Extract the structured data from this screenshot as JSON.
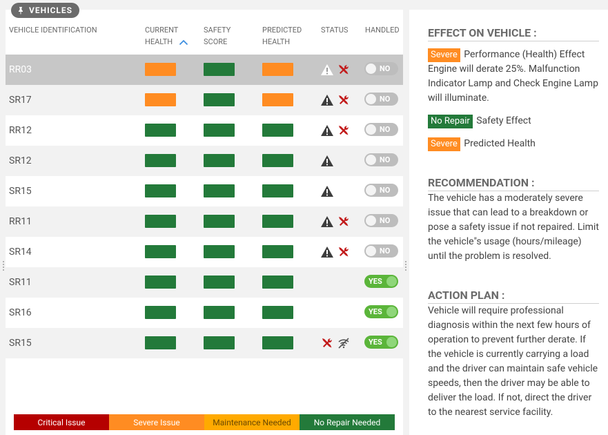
{
  "panel_label": "VEHICLES",
  "columns": {
    "vehicle_id": "VEHICLE IDENTIFICATION",
    "current_health": [
      "CURRENT",
      "HEALTH"
    ],
    "safety_score": [
      "SAFETY",
      "SCORE"
    ],
    "predicted_health": [
      "PREDICTED",
      "HEALTH"
    ],
    "status": "STATUS",
    "handled": "HANDLED"
  },
  "colors": {
    "critical": "#b50000",
    "severe": "#ff8c22",
    "maintenance": "#ffaa00",
    "no_repair": "#237a3a"
  },
  "rows": [
    {
      "id": "RR03",
      "current": "severe",
      "safety": "no_repair",
      "predicted": "severe",
      "status": [
        "warning",
        "wrench"
      ],
      "handled": "NO",
      "selected": true
    },
    {
      "id": "SR17",
      "current": "severe",
      "safety": "no_repair",
      "predicted": "severe",
      "status": [
        "warning",
        "wrench"
      ],
      "handled": "NO"
    },
    {
      "id": "RR12",
      "current": "no_repair",
      "safety": "no_repair",
      "predicted": "no_repair",
      "status": [
        "warning",
        "wrench"
      ],
      "handled": "NO"
    },
    {
      "id": "SR12",
      "current": "no_repair",
      "safety": "no_repair",
      "predicted": "no_repair",
      "status": [
        "warning"
      ],
      "handled": "NO"
    },
    {
      "id": "SR15",
      "current": "no_repair",
      "safety": "no_repair",
      "predicted": "no_repair",
      "status": [
        "warning"
      ],
      "handled": "NO"
    },
    {
      "id": "RR11",
      "current": "no_repair",
      "safety": "no_repair",
      "predicted": "no_repair",
      "status": [
        "warning",
        "wrench"
      ],
      "handled": "NO"
    },
    {
      "id": "SR14",
      "current": "no_repair",
      "safety": "no_repair",
      "predicted": "no_repair",
      "status": [
        "warning",
        "wrench"
      ],
      "handled": "NO"
    },
    {
      "id": "SR11",
      "current": "no_repair",
      "safety": "no_repair",
      "predicted": "no_repair",
      "status": [],
      "handled": "YES"
    },
    {
      "id": "SR16",
      "current": "no_repair",
      "safety": "no_repair",
      "predicted": "no_repair",
      "status": [],
      "handled": "YES"
    },
    {
      "id": "SR15",
      "current": "no_repair",
      "safety": "no_repair",
      "predicted": "no_repair",
      "status": [
        "wrench",
        "no-signal"
      ],
      "handled": "YES"
    }
  ],
  "legend": [
    {
      "label": "Critical Issue",
      "key": "critical"
    },
    {
      "label": "Severe Issue",
      "key": "severe"
    },
    {
      "label": "Maintenance Needed",
      "key": "maintenance"
    },
    {
      "label": "No Repair Needed",
      "key": "no_repair"
    }
  ],
  "detail": {
    "effect_title": "EFFECT ON VEHICLE :",
    "effects": [
      {
        "tag": "Severe",
        "tag_key": "severe",
        "text": "Performance (Health) Effect Engine will derate 25%. Malfunction Indicator Lamp and Check Engine Lamp will illuminate."
      },
      {
        "tag": "No Repair",
        "tag_key": "no_repair",
        "text": "Safety Effect"
      },
      {
        "tag": "Severe",
        "tag_key": "severe",
        "text": "Predicted Health"
      }
    ],
    "recommendation_title": "RECOMMENDATION :",
    "recommendation": "The vehicle has a moderately severe issue that can lead to a breakdown or pose a safety issue if not repaired. Limit the vehicle\"s usage (hours/mileage) until the problem is resolved.",
    "action_title": "ACTION PLAN :",
    "action": "Vehicle will require professional diagnosis within the next few hours of operation to prevent further derate. If the vehicle is currently carrying a load and the driver can maintain safe vehicle speeds, then the driver may be able to deliver the load. If not, direct the driver to the nearest service facility."
  }
}
